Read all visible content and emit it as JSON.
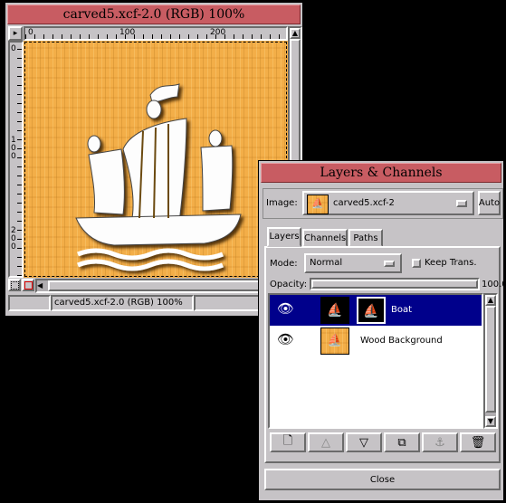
{
  "image_window": {
    "title": "carved5.xcf-2.0 (RGB) 100%",
    "ruler_top": [
      "0",
      "100",
      "200"
    ],
    "ruler_left": [
      "0",
      "100",
      "200"
    ],
    "status_text": "carved5.xcf-2.0 (RGB) 100%",
    "nav_arrow": "◀"
  },
  "layers_dialog": {
    "title": "Layers & Channels",
    "image_label": "Image:",
    "image_value": "carved5.xcf-2",
    "auto_button": "Auto",
    "tabs": [
      {
        "label": "Layers"
      },
      {
        "label": "Channels"
      },
      {
        "label": "Paths"
      }
    ],
    "mode_label": "Mode:",
    "mode_value": "Normal",
    "keep_trans_label": "Keep Trans.",
    "opacity_label": "Opacity:",
    "opacity_value": "100.0",
    "opacity": 1.0,
    "layers": [
      {
        "name": "Boat",
        "visible": true,
        "selected": true
      },
      {
        "name": "Wood Background",
        "visible": true,
        "selected": false
      }
    ],
    "close_button": "Close"
  },
  "colors": {
    "title_bar": "#c85c62",
    "selection": "#00008b",
    "wood": "#f3ae48",
    "window_bg": "#c6c3c6"
  }
}
